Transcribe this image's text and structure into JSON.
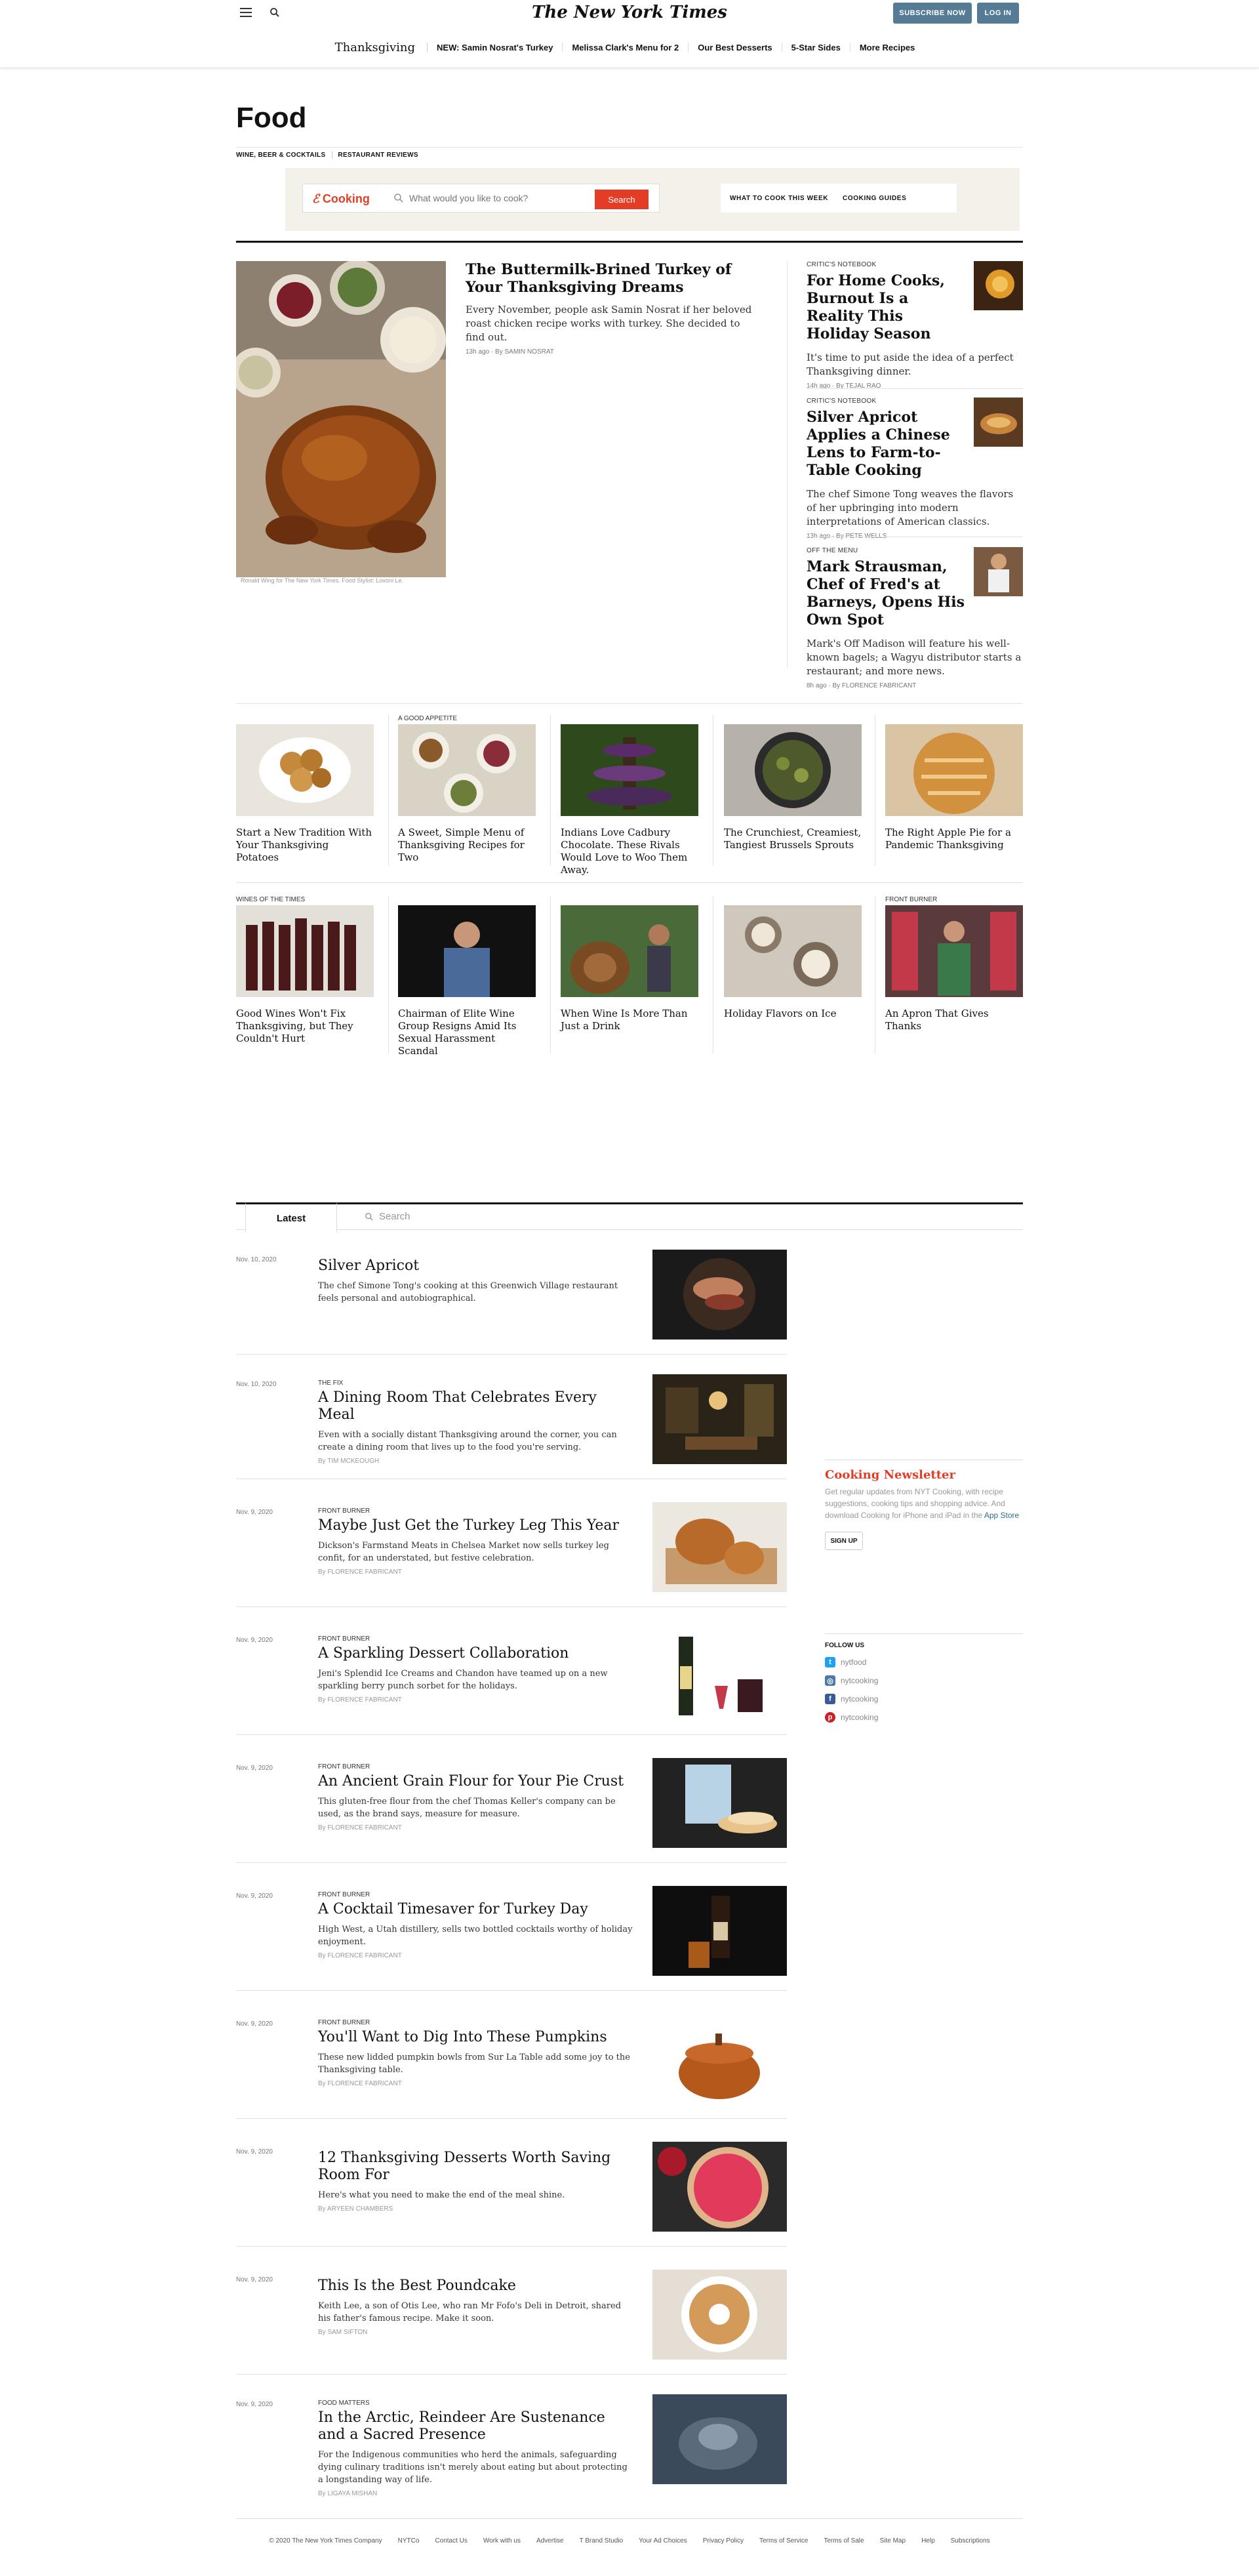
{
  "header": {
    "masthead": "The New York Times",
    "subscribe_label": "SUBSCRIBE NOW",
    "login_label": "LOG IN"
  },
  "subnav": {
    "brand": "Thanksgiving",
    "links": [
      "NEW: Samin Nosrat's Turkey",
      "Melissa Clark's Menu for 2",
      "Our Best Desserts",
      "5-Star Sides",
      "More Recipes"
    ]
  },
  "section": {
    "title": "Food",
    "links": [
      "WINE, BEER & COCKTAILS",
      "RESTAURANT REVIEWS"
    ]
  },
  "cooking": {
    "logo": "Cooking",
    "placeholder": "What would you like to cook?",
    "search_label": "Search",
    "link1": "WHAT TO COOK THIS WEEK",
    "link2": "COOKING GUIDES"
  },
  "lead": {
    "headline": "The Buttermilk-Brined Turkey of Your Thanksgiving Dreams",
    "summary": "Every November, people ask Samin Nosrat if her beloved roast chicken recipe works with turkey. She decided to find out.",
    "byline": "13h ago · By SAMIN NOSRAT",
    "credit": "Ronald Wing for The New York Times. Food Stylist: Lovoni Le."
  },
  "side": [
    {
      "kicker": "CRITIC'S NOTEBOOK",
      "headline": "For Home Cooks, Burnout Is a Reality This Holiday Season",
      "summary": "It's time to put aside the idea of a perfect Thanksgiving dinner.",
      "byline": "14h ago · By TEJAL RAO"
    },
    {
      "kicker": "CRITIC'S NOTEBOOK",
      "headline": "Silver Apricot Applies a Chinese Lens to Farm-to-Table Cooking",
      "summary": "The chef Simone Tong weaves the flavors of her upbringing into modern interpretations of American classics.",
      "byline": "13h ago · By PETE WELLS"
    },
    {
      "kicker": "OFF THE MENU",
      "headline": "Mark Strausman, Chef of Fred's at Barneys, Opens His Own Spot",
      "summary": "Mark's Off Madison will feature his well-known bagels; a Wagyu distributor starts a restaurant; and more news.",
      "byline": "8h ago · By FLORENCE FABRICANT"
    }
  ],
  "row1": [
    {
      "kicker": "",
      "headline": "Start a New Tradition With Your Thanksgiving Potatoes"
    },
    {
      "kicker": "A GOOD APPETITE",
      "headline": "A Sweet, Simple Menu of Thanksgiving Recipes for Two"
    },
    {
      "kicker": "",
      "headline": "Indians Love Cadbury Chocolate. These Rivals Would Love to Woo Them Away."
    },
    {
      "kicker": "",
      "headline": "The Crunchiest, Creamiest, Tangiest Brussels Sprouts"
    },
    {
      "kicker": "",
      "headline": "The Right Apple Pie for a Pandemic Thanksgiving"
    }
  ],
  "row2": [
    {
      "kicker": "WINES OF THE TIMES",
      "headline": "Good Wines Won't Fix Thanksgiving, but They Couldn't Hurt"
    },
    {
      "kicker": "",
      "headline": "Chairman of Elite Wine Group Resigns Amid Its Sexual Harassment Scandal"
    },
    {
      "kicker": "",
      "headline": "When Wine Is More Than Just a Drink"
    },
    {
      "kicker": "",
      "headline": "Holiday Flavors on Ice"
    },
    {
      "kicker": "FRONT BURNER",
      "headline": "An Apron That Gives Thanks"
    }
  ],
  "latest": {
    "tab_label": "Latest",
    "search_placeholder": "Search",
    "items": [
      {
        "date": "Nov. 10, 2020",
        "kicker": "",
        "headline": "Silver Apricot",
        "summary": "The chef Simone Tong's cooking at this Greenwich Village restaurant feels personal and autobiographical.",
        "byline": ""
      },
      {
        "date": "Nov. 10, 2020",
        "kicker": "THE FIX",
        "headline": "A Dining Room That Celebrates Every Meal",
        "summary": "Even with a socially distant Thanksgiving around the corner, you can create a dining room that lives up to the food you're serving.",
        "byline": "By TIM MCKEOUGH"
      },
      {
        "date": "Nov. 9, 2020",
        "kicker": "FRONT BURNER",
        "headline": "Maybe Just Get the Turkey Leg This Year",
        "summary": "Dickson's Farmstand Meats in Chelsea Market now sells turkey leg confit, for an understated, but festive celebration.",
        "byline": "By FLORENCE FABRICANT"
      },
      {
        "date": "Nov. 9, 2020",
        "kicker": "FRONT BURNER",
        "headline": "A Sparkling Dessert Collaboration",
        "summary": "Jeni's Splendid Ice Creams and Chandon have teamed up on a new sparkling berry punch sorbet for the holidays.",
        "byline": "By FLORENCE FABRICANT"
      },
      {
        "date": "Nov. 9, 2020",
        "kicker": "FRONT BURNER",
        "headline": "An Ancient Grain Flour for Your Pie Crust",
        "summary": "This gluten-free flour from the chef Thomas Keller's company can be used, as the brand says, measure for measure.",
        "byline": "By FLORENCE FABRICANT"
      },
      {
        "date": "Nov. 9, 2020",
        "kicker": "FRONT BURNER",
        "headline": "A Cocktail Timesaver for Turkey Day",
        "summary": "High West, a Utah distillery, sells two bottled cocktails worthy of holiday enjoyment.",
        "byline": "By FLORENCE FABRICANT"
      },
      {
        "date": "Nov. 9, 2020",
        "kicker": "FRONT BURNER",
        "headline": "You'll Want to Dig Into These Pumpkins",
        "summary": "These new lidded pumpkin bowls from Sur La Table add some joy to the Thanksgiving table.",
        "byline": "By FLORENCE FABRICANT"
      },
      {
        "date": "Nov. 9, 2020",
        "kicker": "",
        "headline": "12 Thanksgiving Desserts Worth Saving Room For",
        "summary": "Here's what you need to make the end of the meal shine.",
        "byline": "By ARYEEN CHAMBERS"
      },
      {
        "date": "Nov. 9, 2020",
        "kicker": "",
        "headline": "This Is the Best Poundcake",
        "summary": "Keith Lee, a son of Otis Lee, who ran Mr Fofo's Deli in Detroit, shared his father's famous recipe. Make it soon.",
        "byline": "By SAM SIFTON"
      },
      {
        "date": "Nov. 9, 2020",
        "kicker": "FOOD MATTERS",
        "headline": "In the Arctic, Reindeer Are Sustenance and a Sacred Presence",
        "summary": "For the Indigenous communities who herd the animals, safeguarding dying culinary traditions isn't merely about eating but about protecting a longstanding way of life.",
        "byline": "By LIGAYA MISHAN"
      }
    ]
  },
  "newsletter": {
    "title": "Cooking Newsletter",
    "body": "Get regular updates from NYT Cooking, with recipe suggestions, cooking tips and shopping advice. And download Cooking for iPhone and iPad in the",
    "link": "App Store",
    "button": "SIGN UP"
  },
  "follow": {
    "title": "FOLLOW US",
    "accounts": [
      "nytfood",
      "nytcooking",
      "nytcooking",
      "nytcooking"
    ]
  },
  "footer": {
    "links": [
      "© 2020 The New York Times Company",
      "NYTCo",
      "Contact Us",
      "Work with us",
      "Advertise",
      "T Brand Studio",
      "Your Ad Choices",
      "Privacy Policy",
      "Terms of Service",
      "Terms of Sale",
      "Site Map",
      "Help",
      "Subscriptions"
    ]
  },
  "colors": {
    "accent": "#e33d26",
    "button_blue": "#567b95",
    "link_blue": "#326891"
  }
}
